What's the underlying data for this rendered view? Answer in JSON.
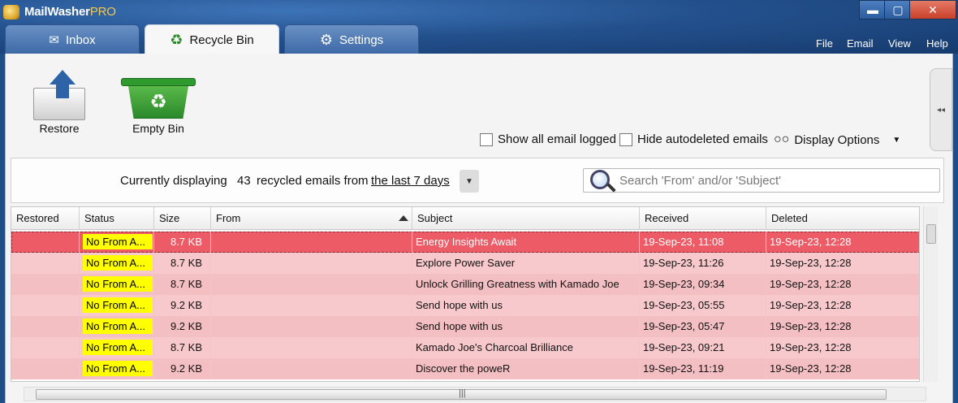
{
  "app": {
    "title_main": "MailWasher",
    "title_pro": "PRO"
  },
  "window": {
    "minimize": "▬",
    "maximize": "▢",
    "close": "✕"
  },
  "menu": [
    "File",
    "Email",
    "View",
    "Help"
  ],
  "tabs": [
    {
      "label": "Inbox",
      "icon": "envelope-icon"
    },
    {
      "label": "Recycle Bin",
      "icon": "recycle-icon"
    },
    {
      "label": "Settings",
      "icon": "gear-icon"
    }
  ],
  "toolbar": {
    "restore_label": "Restore",
    "empty_label": "Empty Bin"
  },
  "options": {
    "show_all": "Show all email logged",
    "hide_autodeleted": "Hide autodeleted emails",
    "display_options": "Display Options"
  },
  "filter": {
    "prefix": "Currently displaying",
    "count": "43",
    "middle": "recycled emails from",
    "range": "the last 7 days",
    "search_placeholder": "Search 'From' and/or 'Subject'"
  },
  "columns": [
    "Restored",
    "Status",
    "Size",
    "From",
    "Subject",
    "Received",
    "Deleted"
  ],
  "rows": [
    {
      "status": "No From A...",
      "size": "8.7 KB",
      "from": "",
      "subject": "Energy Insights Await",
      "received": "19-Sep-23, 11:08",
      "deleted": "19-Sep-23, 12:28"
    },
    {
      "status": "No From A...",
      "size": "8.7 KB",
      "from": "",
      "subject": "Explore Power Saver",
      "received": "19-Sep-23, 11:26",
      "deleted": "19-Sep-23, 12:28"
    },
    {
      "status": "No From A...",
      "size": "8.7 KB",
      "from": "",
      "subject": "Unlock Grilling Greatness with Kamado Joe",
      "received": "19-Sep-23, 09:34",
      "deleted": "19-Sep-23, 12:28"
    },
    {
      "status": "No From A...",
      "size": "9.2 KB",
      "from": "",
      "subject": "Send hope with us",
      "received": "19-Sep-23, 05:55",
      "deleted": "19-Sep-23, 12:28"
    },
    {
      "status": "No From A...",
      "size": "9.2 KB",
      "from": "",
      "subject": "Send hope with us",
      "received": "19-Sep-23, 05:47",
      "deleted": "19-Sep-23, 12:28"
    },
    {
      "status": "No From A...",
      "size": "8.7 KB",
      "from": "",
      "subject": "Kamado Joe's Charcoal Brilliance",
      "received": "19-Sep-23, 09:21",
      "deleted": "19-Sep-23, 12:28"
    },
    {
      "status": "No From A...",
      "size": "9.2 KB",
      "from": "",
      "subject": "Discover the poweR",
      "received": "19-Sep-23, 11:19",
      "deleted": "19-Sep-23, 12:28"
    }
  ],
  "colors": {
    "selected_row": "#ec5b66",
    "row_pink": "#f8c9cc",
    "status_badge": "#ffff00",
    "frame_blue": "#23508c"
  }
}
